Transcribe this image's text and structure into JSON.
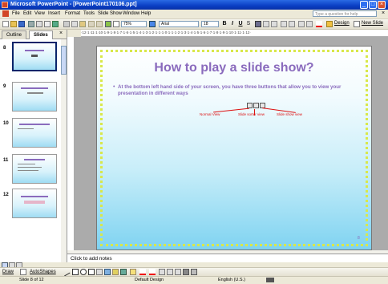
{
  "window": {
    "title": "Microsoft PowerPoint - [PowerPoint170106.ppt]"
  },
  "menu": {
    "items": [
      "File",
      "Edit",
      "View",
      "Insert",
      "Format",
      "Tools",
      "Slide Show",
      "Window",
      "Help"
    ],
    "help_placeholder": "Type a question for help"
  },
  "toolbar": {
    "zoom": "75%",
    "font": "Arial",
    "font_size": "18",
    "bold": "B",
    "italic": "I",
    "underline": "U",
    "shadow": "S",
    "design_label": "Design",
    "new_slide_label": "New Slide"
  },
  "outline_pane": {
    "tabs": [
      "Outline",
      "Slides"
    ],
    "active_tab": "Slides",
    "close": "×",
    "thumbnails": [
      {
        "number": "8",
        "title": ""
      },
      {
        "number": "9",
        "title": ""
      },
      {
        "number": "10",
        "title": ""
      },
      {
        "number": "11",
        "title": ""
      },
      {
        "number": "12",
        "title": ""
      }
    ]
  },
  "ruler": {
    "h_ticks": "·12·1·11·1·10·1·9·1·8·1·7·1·6·1·5·1·4·1·3·1·2·1·1·1·0·1·1·1·2·1·3·1·4·1·5·1·6·1·7·1·8·1·9·1·10·1·11·1·12·"
  },
  "slide": {
    "title": "How to play a slide show?",
    "bullet": "At the bottom left hand side of your screen, you have three buttons that allow you to view your presentation in different ways",
    "callouts": {
      "normal": "Normal View",
      "sorter": "Slide sorter view",
      "show": "Slide show view"
    },
    "number": "8"
  },
  "notes": {
    "placeholder": "Click to add notes"
  },
  "drawing_toolbar": {
    "draw": "Draw",
    "autoshapes": "AutoShapes"
  },
  "status": {
    "slide_of": "Slide 8 of 12",
    "design": "Default Design",
    "language": "English (U.S.)"
  },
  "colors": {
    "title_purple": "#8a6bbd",
    "callout_red": "#dd1111",
    "dot_border": "#d9e84a",
    "titlebar_blue": "#0a3fc4"
  }
}
